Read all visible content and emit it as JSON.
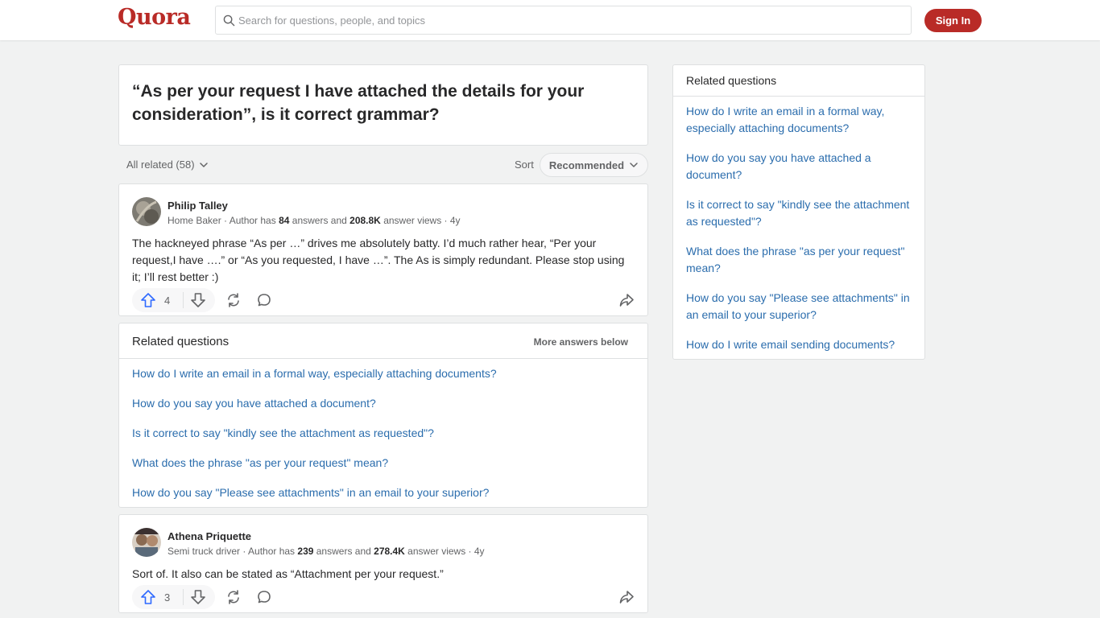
{
  "header": {
    "logo": "Quora",
    "search_placeholder": "Search for questions, people, and topics",
    "signin_label": "Sign In"
  },
  "question": {
    "title": "“As per your request I have attached the details for your consideration”, is it correct grammar?"
  },
  "filters": {
    "all_related": "All related (58)",
    "sort_label": "Sort",
    "sort_value": "Recommended"
  },
  "answers": [
    {
      "author": "Philip Talley",
      "role": "Home Baker · Author has ",
      "answers_count": "84",
      "mid": " answers and ",
      "views": "208.8K",
      "tail": " answer views · 4y",
      "text": "The hackneyed phrase “As per …” drives me absolutely batty. I’d much rather hear, “Per your request,I have ….” or “As you requested, I have …”. The As is simply redundant. Please stop using it; I’ll rest better :)",
      "upvotes": "4"
    },
    {
      "author": "Athena Priquette",
      "role": "Semi truck driver · Author has ",
      "answers_count": "239",
      "mid": " answers and ",
      "views": "278.4K",
      "tail": " answer views · 4y",
      "text": "Sort of. It also can be stated as “Attachment per your request.”",
      "upvotes": "3"
    }
  ],
  "related_inline": {
    "title": "Related questions",
    "more": "More answers below",
    "items": [
      "How do I write an email in a formal way, especially attaching documents?",
      "How do you say you have attached a document?",
      "Is it correct to say \"kindly see the attachment as requested\"?",
      "What does the phrase \"as per your request\" mean?",
      "How do you say \"Please see attachments\" in an email to your superior?"
    ]
  },
  "sidebar": {
    "title": "Related questions",
    "items": [
      "How do I write an email in a formal way, especially attaching documents?",
      "How do you say you have attached a document?",
      "Is it correct to say \"kindly see the attachment as requested\"?",
      "What does the phrase \"as per your request\" mean?",
      "How do you say \"Please see attachments\" in an email to your superior?",
      "How do I write email sending documents?"
    ]
  },
  "colors": {
    "brand": "#b92b27",
    "link": "#2b6dad",
    "upvote": "#2e69ff"
  }
}
